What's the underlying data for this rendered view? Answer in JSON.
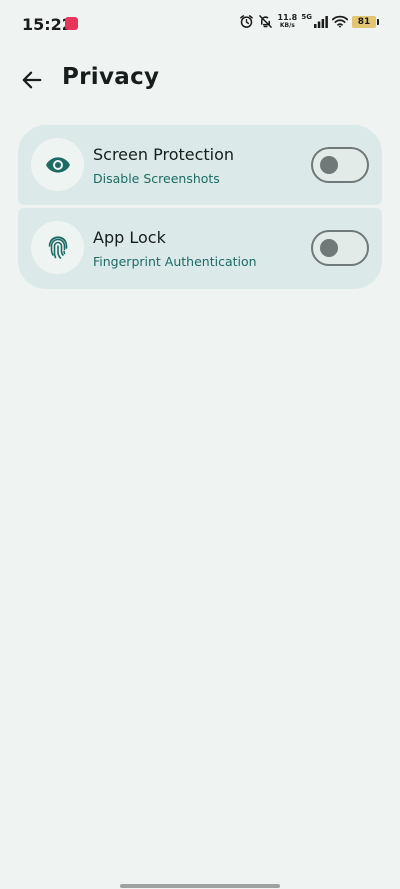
{
  "status_bar": {
    "time": "15:22",
    "net_speed_value": "11.8",
    "net_speed_unit": "KB/s",
    "network_type": "5G",
    "battery_level": "81",
    "icons": [
      "notification-app-icon",
      "alarm-icon",
      "notifications-off-icon",
      "signal-icon",
      "wifi-icon",
      "battery-icon"
    ]
  },
  "header": {
    "title": "Privacy",
    "back_icon": "arrow-back-icon"
  },
  "settings": [
    {
      "title": "Screen Protection",
      "subtitle": "Disable Screenshots",
      "icon": "eye-icon",
      "enabled": false
    },
    {
      "title": "App Lock",
      "subtitle": "Fingerprint Authentication",
      "icon": "fingerprint-icon",
      "enabled": false
    }
  ],
  "colors": {
    "background": "#eff4f2",
    "card": "#dbeae8",
    "accent": "#1d6a64",
    "toggle_outline": "#6f7978"
  }
}
